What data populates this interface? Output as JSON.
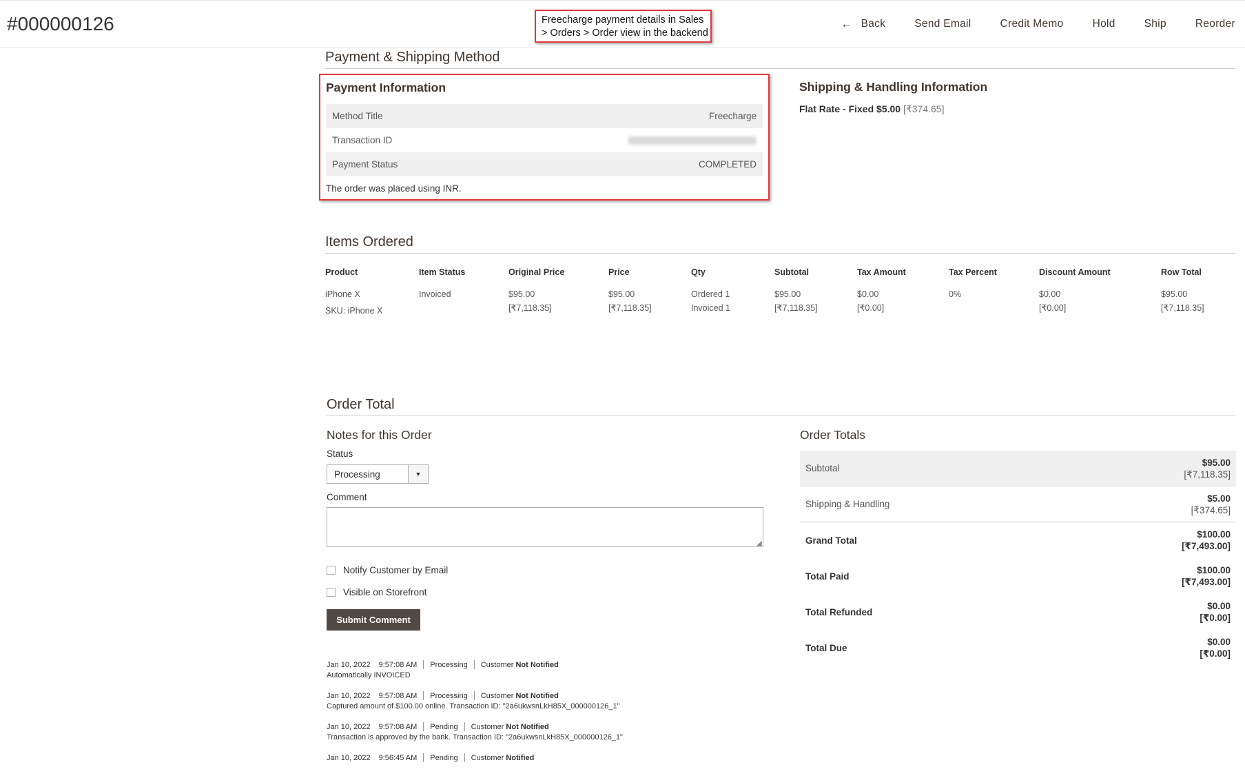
{
  "header": {
    "order_number": "#000000126",
    "callout": "Freecharge payment details in Sales > Orders > Order view in the backend",
    "actions": {
      "back": "Back",
      "send_email": "Send Email",
      "credit_memo": "Credit Memo",
      "hold": "Hold",
      "ship": "Ship",
      "reorder": "Reorder"
    }
  },
  "payment_shipping": {
    "section_title": "Payment & Shipping Method",
    "payment": {
      "title": "Payment Information",
      "rows": [
        {
          "label": "Method Title",
          "value": "Freecharge"
        },
        {
          "label": "Transaction ID",
          "value": ""
        },
        {
          "label": "Payment Status",
          "value": "COMPLETED"
        }
      ],
      "note": "The order was placed using INR."
    },
    "shipping": {
      "title": "Shipping & Handling Information",
      "method": "Flat Rate - Fixed $5.00",
      "converted": "[₹374.65]"
    }
  },
  "items_ordered": {
    "title": "Items Ordered",
    "headers": [
      "Product",
      "Item Status",
      "Original Price",
      "Price",
      "Qty",
      "Subtotal",
      "Tax Amount",
      "Tax Percent",
      "Discount Amount",
      "Row Total"
    ],
    "row": {
      "product_name": "iPhone X",
      "sku": "SKU: iPhone X",
      "item_status": "Invoiced",
      "original_price": "$95.00",
      "original_price_conv": "[₹7,118.35]",
      "price": "$95.00",
      "price_conv": "[₹7,118.35]",
      "qty_ordered": "Ordered 1",
      "qty_invoiced": "Invoiced 1",
      "subtotal": "$95.00",
      "subtotal_conv": "[₹7,118.35]",
      "tax_amount": "$0.00",
      "tax_amount_conv": "[₹0.00]",
      "tax_percent": "0%",
      "discount": "$0.00",
      "discount_conv": "[₹0.00]",
      "row_total": "$95.00",
      "row_total_conv": "[₹7,118.35]"
    }
  },
  "order_total": {
    "title": "Order Total",
    "notes": {
      "title": "Notes for this Order",
      "status_label": "Status",
      "status_value": "Processing",
      "comment_label": "Comment",
      "notify_label": "Notify Customer by Email",
      "visible_label": "Visible on Storefront",
      "submit_label": "Submit Comment"
    },
    "history": [
      {
        "date": "Jan 10, 2022",
        "time": "9:57:08 AM",
        "status": "Processing",
        "customer": "Customer",
        "notified": "Not Notified",
        "note": "Automatically INVOICED"
      },
      {
        "date": "Jan 10, 2022",
        "time": "9:57:08 AM",
        "status": "Processing",
        "customer": "Customer",
        "notified": "Not Notified",
        "note": "Captured amount of $100.00 online. Transaction ID: \"2a6ukwsnLkH85X_000000126_1\""
      },
      {
        "date": "Jan 10, 2022",
        "time": "9:57:08 AM",
        "status": "Pending",
        "customer": "Customer",
        "notified": "Not Notified",
        "note": "Transaction is approved by the bank. Transaction ID: \"2a6ukwsnLkH85X_000000126_1\""
      },
      {
        "date": "Jan 10, 2022",
        "time": "9:56:45 AM",
        "status": "Pending",
        "customer": "Customer",
        "notified": "Notified",
        "note": ""
      }
    ],
    "totals": {
      "title": "Order Totals",
      "subtotal": {
        "label": "Subtotal",
        "value": "$95.00",
        "conv": "[₹7,118.35]"
      },
      "shipping": {
        "label": "Shipping & Handling",
        "value": "$5.00",
        "conv": "[₹374.65]"
      },
      "grand_total": {
        "label": "Grand Total",
        "value": "$100.00",
        "conv": "[₹7,493.00]"
      },
      "total_paid": {
        "label": "Total Paid",
        "value": "$100.00",
        "conv": "[₹7,493.00]"
      },
      "total_refunded": {
        "label": "Total Refunded",
        "value": "$0.00",
        "conv": "[₹0.00]"
      },
      "total_due": {
        "label": "Total Due",
        "value": "$0.00",
        "conv": "[₹0.00]"
      }
    }
  },
  "colors": {
    "accent_red": "#e0393e",
    "button_dark": "#514943",
    "stripe": "#f0f0f0"
  }
}
